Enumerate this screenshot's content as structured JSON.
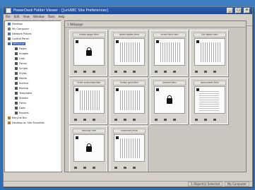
{
  "window": {
    "title": "PowerDesk Folder Viewer - [Jun\\ABC Site Preferences]"
  },
  "titlebar_buttons": [
    "_",
    "□",
    "×"
  ],
  "menus": [
    "File",
    "Edit",
    "View",
    "Window",
    "Tools",
    "Help"
  ],
  "toolbar_icons": [
    "back-icon",
    "forward-icon",
    "up-icon",
    "cut-icon",
    "copy-icon",
    "paste-icon",
    "delete-icon",
    "properties-icon",
    "views-icon"
  ],
  "tree": [
    {
      "label": "Desktop",
      "color": "#4a78c0"
    },
    {
      "label": "My Computer",
      "color": "#7a7a7a"
    },
    {
      "label": "Network Places",
      "color": "#4a78c0"
    },
    {
      "label": "Control Panel",
      "color": "#6a6a6a"
    },
    {
      "label": "Webpage",
      "color": "#3b6bbf",
      "selected": true
    },
    {
      "label": "Pages",
      "color": "#555"
    },
    {
      "label": "Images",
      "color": "#555"
    },
    {
      "label": "Lists",
      "color": "#555"
    },
    {
      "label": "Forms",
      "color": "#555"
    },
    {
      "label": "Scripts",
      "color": "#555"
    },
    {
      "label": "Styles",
      "color": "#555"
    },
    {
      "label": "Media",
      "color": "#555"
    },
    {
      "label": "Archive",
      "color": "#555"
    },
    {
      "label": "Backup",
      "color": "#555"
    },
    {
      "label": "Templates",
      "color": "#555"
    },
    {
      "label": "Shared",
      "color": "#555"
    },
    {
      "label": "Fonts",
      "color": "#555"
    },
    {
      "label": "Data",
      "color": "#555"
    },
    {
      "label": "Reports",
      "color": "#555"
    },
    {
      "label": "Recycle Bin",
      "color": "#c0772a"
    },
    {
      "label": "Desktop on Site Favorites",
      "color": "#c0772a"
    }
  ],
  "right_pane": {
    "header": "1 Webpage"
  },
  "cards": [
    {
      "caption": "index page.htm",
      "kind": "lock"
    },
    {
      "caption": "data tables.htm",
      "kind": "fill"
    },
    {
      "caption": "chart lists.htm",
      "kind": "fill"
    },
    {
      "caption": "list table.htm",
      "kind": "fill"
    },
    {
      "caption": "lines overview.htm",
      "kind": "fill"
    },
    {
      "caption": "index grid.htm",
      "kind": "fill"
    },
    {
      "caption": "locked.htm",
      "kind": "lock"
    },
    {
      "caption": "document.htm",
      "kind": "doc"
    },
    {
      "caption": "backup.htm",
      "kind": "lock"
    },
    {
      "caption": "summary.htm",
      "kind": "fill"
    }
  ],
  "status": {
    "left": "1 Object(s) Selected",
    "right": "My Computer"
  },
  "colors": {
    "desktop": "#2f6fb3",
    "titlebar": "#2a5db0",
    "selection": "#1f4fa0"
  }
}
